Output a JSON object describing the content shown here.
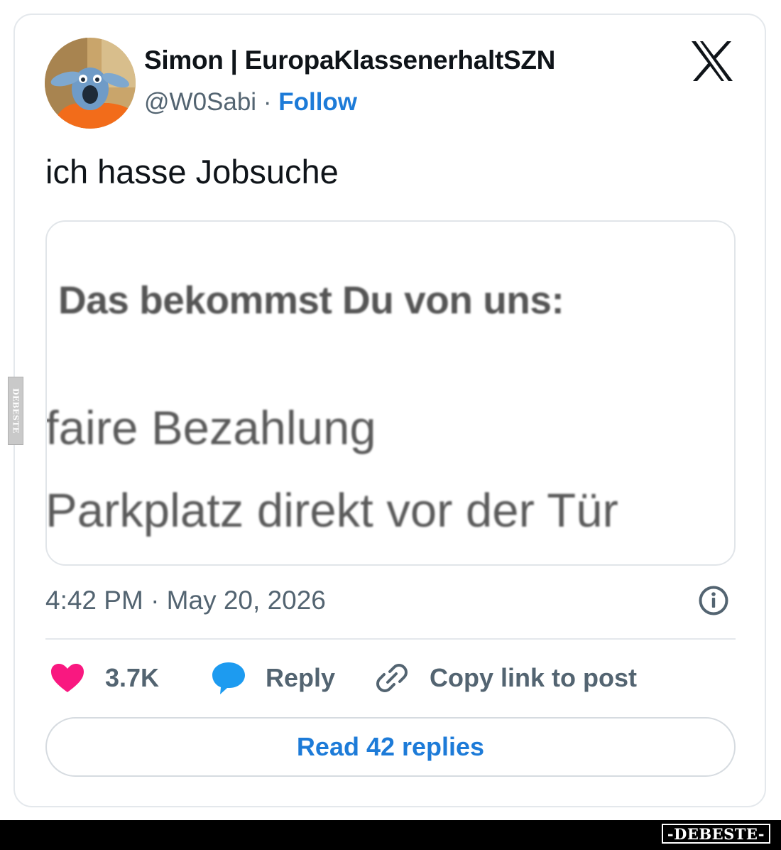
{
  "author": {
    "display_name": "Simon | EuropaKlassenerhaltSZN",
    "handle": "@W0Sabi",
    "separator": "·",
    "follow_label": "Follow",
    "avatar_icon": "avatar-blue-creature-orange-shirt"
  },
  "platform_icon": "x-logo-icon",
  "tweet": {
    "text": "ich hasse Jobsuche"
  },
  "media": {
    "heading": "Das bekommst Du von uns:",
    "lines": [
      "faire Bezahlung",
      "Parkplatz direkt vor der Tür"
    ]
  },
  "meta": {
    "timestamp": "4:42 PM · May 20, 2026",
    "info_icon": "info-icon"
  },
  "actions": {
    "likes": "3.7K",
    "reply_label": "Reply",
    "copy_label": "Copy link to post"
  },
  "read_replies_label": "Read 42 replies",
  "watermarks": {
    "side": "DEBESTE",
    "footer": "-DEBESTE-"
  },
  "colors": {
    "follow_blue": "#1d7bd8",
    "heart_pink": "#f91880",
    "reply_blue": "#1d9bf0",
    "secondary_gray": "#536471"
  }
}
